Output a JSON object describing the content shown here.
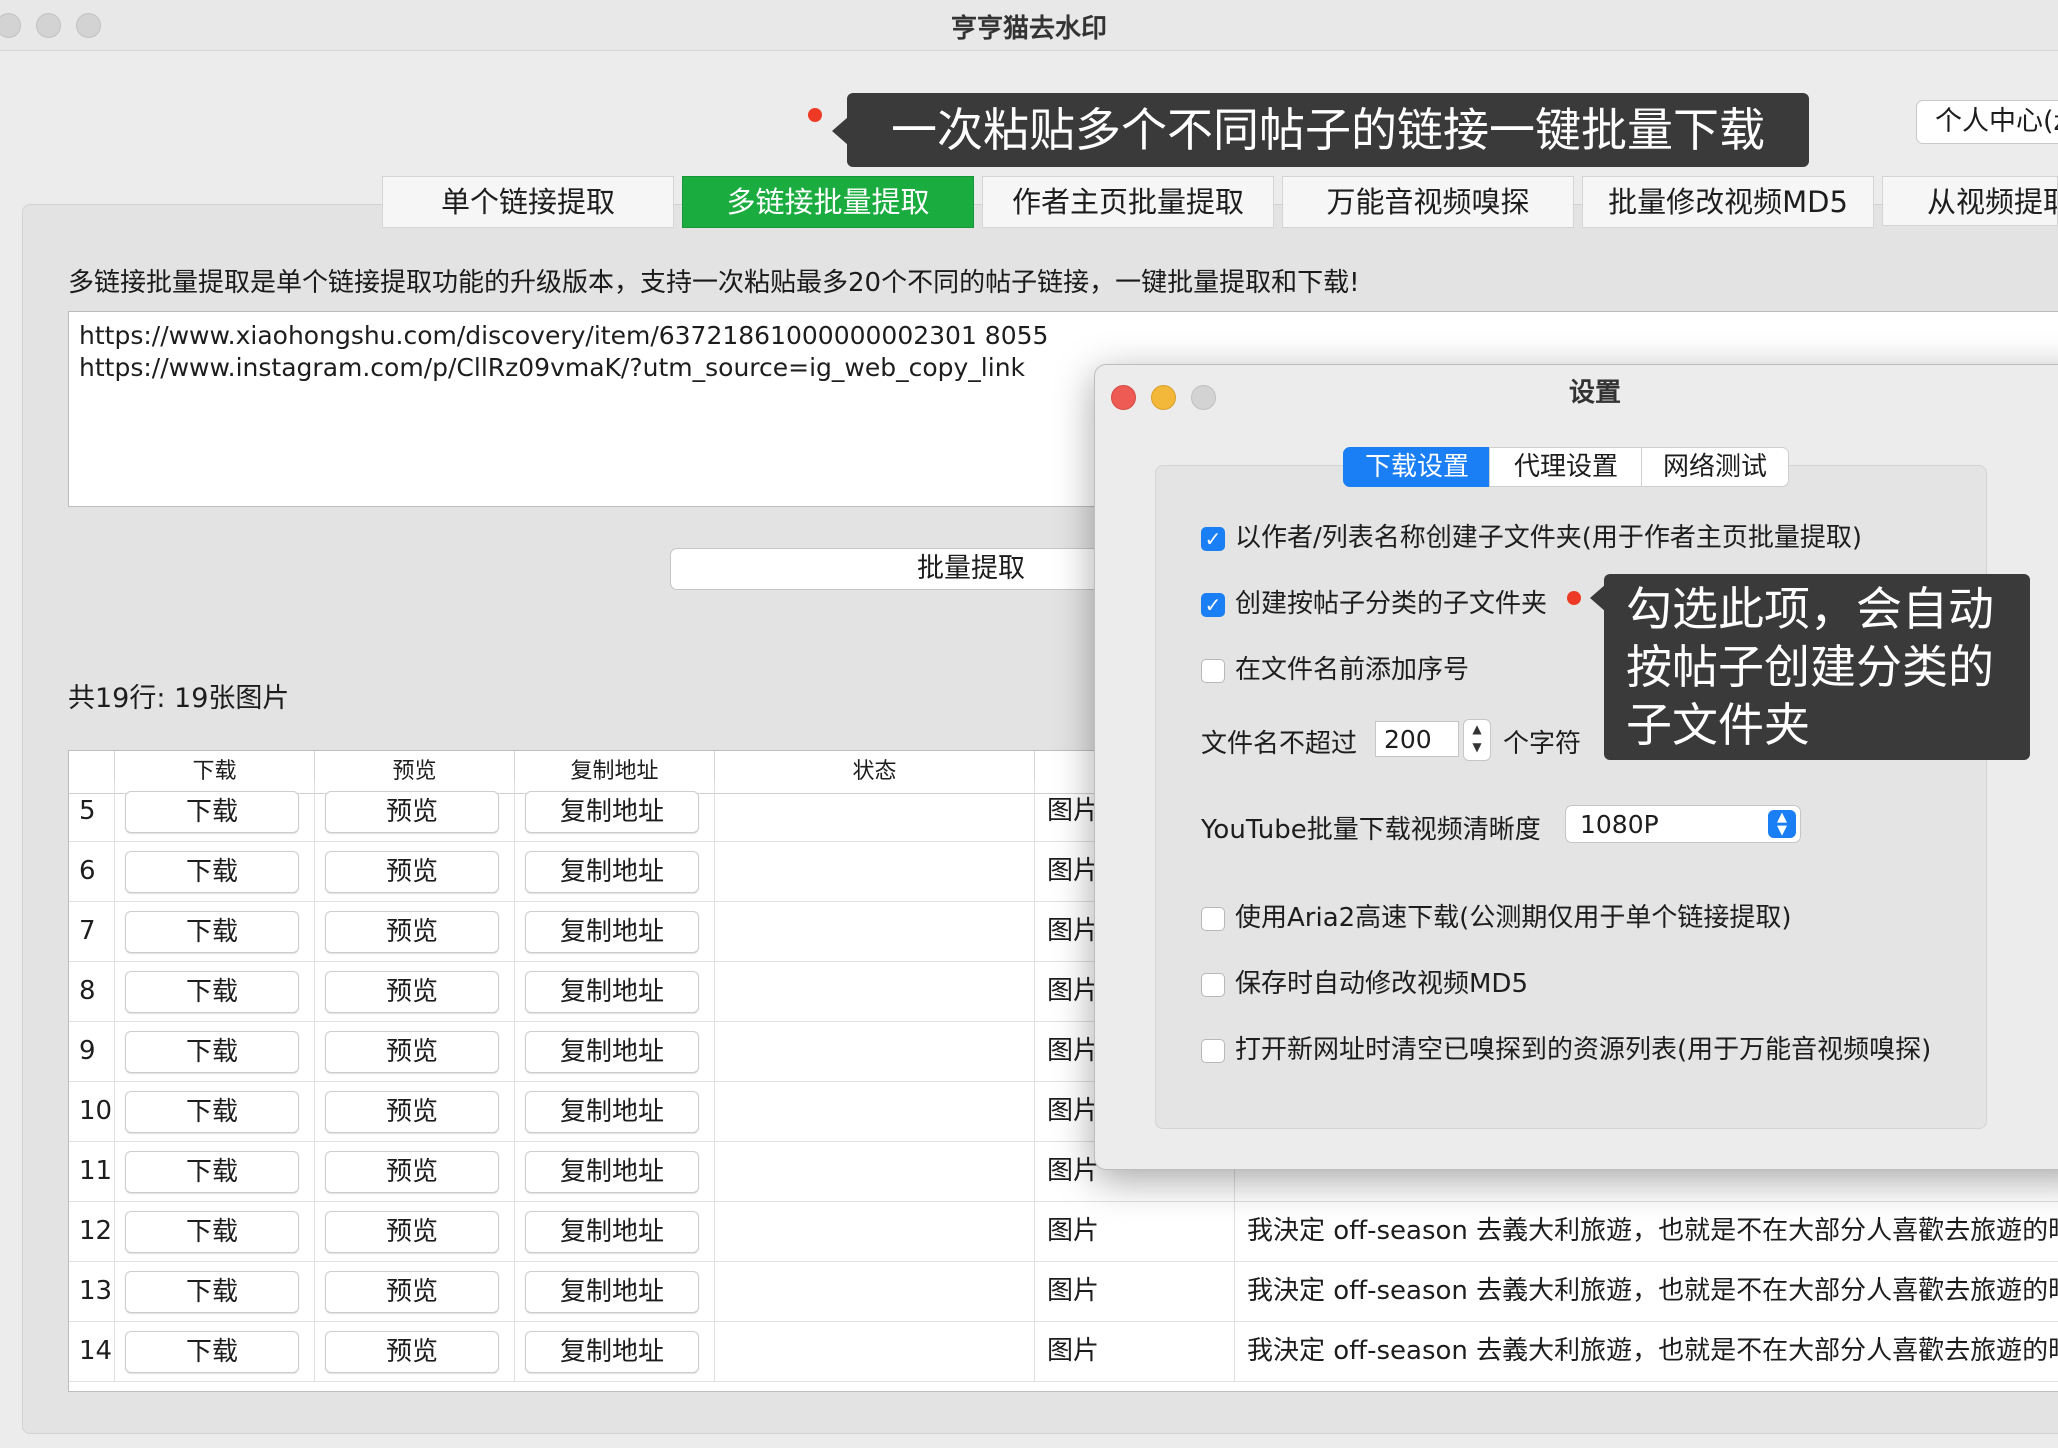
{
  "window": {
    "title": "亨亨猫去水印"
  },
  "annotations": {
    "top_bubble": "一次粘贴多个不同帖子的链接一键批量下载",
    "side_bubble": [
      "勾选此项，会自动",
      "按帖子创建分类的",
      "子文件夹"
    ]
  },
  "header": {
    "profile_label": "个人中心(z"
  },
  "tabs": [
    {
      "label": "单个链接提取",
      "active": false
    },
    {
      "label": "多链接批量提取",
      "active": true
    },
    {
      "label": "作者主页批量提取",
      "active": false
    },
    {
      "label": "万能音视频嗅探",
      "active": false
    },
    {
      "label": "批量修改视频MD5",
      "active": false
    },
    {
      "label": "从视频提取",
      "active": false
    }
  ],
  "main": {
    "description": "多链接批量提取是单个链接提取功能的升级版本，支持一次粘贴最多20个不同的帖子链接，一键批量提取和下载!",
    "urls": [
      "https://www.xiaohongshu.com/discovery/item/63721861000000002301 8055",
      "https://www.instagram.com/p/CllRz09vmaK/?utm_source=ig_web_copy_link"
    ],
    "extract_button": "批量提取",
    "count_label": "共19行: 19张图片"
  },
  "table": {
    "headers": [
      "下载",
      "预览",
      "复制地址",
      "状态"
    ],
    "download_label": "下载",
    "preview_label": "预览",
    "copy_label": "复制地址",
    "rows": [
      {
        "num": "5",
        "type": "图片",
        "title": ""
      },
      {
        "num": "6",
        "type": "图片",
        "title": ""
      },
      {
        "num": "7",
        "type": "图片",
        "title": ""
      },
      {
        "num": "8",
        "type": "图片",
        "title": ""
      },
      {
        "num": "9",
        "type": "图片",
        "title": ""
      },
      {
        "num": "10",
        "type": "图片",
        "title": ""
      },
      {
        "num": "11",
        "type": "图片",
        "title": ""
      },
      {
        "num": "12",
        "type": "图片",
        "title": "我決定 off-season 去義大利旅遊，也就是不在大部分人喜歡去旅遊的時"
      },
      {
        "num": "13",
        "type": "图片",
        "title": "我決定 off-season 去義大利旅遊，也就是不在大部分人喜歡去旅遊的時"
      },
      {
        "num": "14",
        "type": "图片",
        "title": "我決定 off-season 去義大利旅遊，也就是不在大部分人喜歡去旅遊的時"
      }
    ]
  },
  "settings": {
    "title": "设置",
    "tabs": [
      {
        "label": "下载设置",
        "active": true
      },
      {
        "label": "代理设置",
        "active": false
      },
      {
        "label": "网络测试",
        "active": false
      }
    ],
    "options": [
      {
        "label": "以作者/列表名称创建子文件夹(用于作者主页批量提取)",
        "checked": true
      },
      {
        "label": "创建按帖子分类的子文件夹",
        "checked": true
      },
      {
        "label": "在文件名前添加序号",
        "checked": false
      }
    ],
    "filename_prefix": "文件名不超过",
    "filename_value": "200",
    "filename_suffix": "个字符",
    "youtube_label": "YouTube批量下载视频清晰度",
    "youtube_value": "1080P",
    "options2": [
      {
        "label": "使用Aria2高速下载(公测期仅用于单个链接提取)",
        "checked": false
      },
      {
        "label": "保存时自动修改视频MD5",
        "checked": false
      },
      {
        "label": "打开新网址时清空已嗅探到的资源列表(用于万能音视频嗅探)",
        "checked": false
      }
    ]
  },
  "colors": {
    "accent_green": "#1aac3f",
    "accent_blue": "#1a7ef5",
    "close_red": "#ee5b55",
    "minimize_yellow": "#f3b739",
    "annotation_red": "#ee3a24"
  }
}
